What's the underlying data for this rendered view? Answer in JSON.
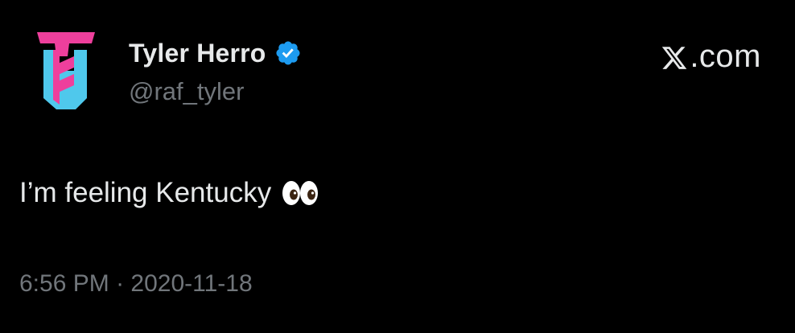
{
  "author": {
    "display_name": "Tyler Herro",
    "handle": "@raf_tyler",
    "verified": true,
    "avatar_icon": "th-monogram-logo",
    "avatar_colors": {
      "pink": "#ee3f9c",
      "cyan": "#4fc8ec"
    }
  },
  "brand": {
    "label": ".com",
    "icon": "x-logo-icon"
  },
  "tweet": {
    "text": "I’m feeling Kentucky",
    "emoji_icon": "eyes-icon"
  },
  "meta": {
    "time": "6:56 PM",
    "separator": "·",
    "date": "2020-11-18"
  },
  "colors": {
    "background": "#000000",
    "primary_text": "#e7e9ea",
    "secondary_text": "#71767b",
    "verified_blue": "#1d9bf0"
  }
}
